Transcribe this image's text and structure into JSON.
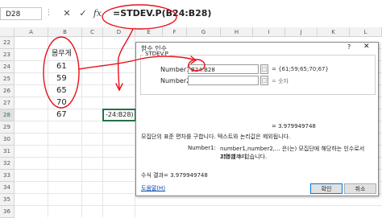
{
  "formula_bar": {
    "name_box": "D28",
    "cancel_icon": "✕",
    "enter_icon": "✓",
    "fx_label": "fx",
    "formula": "=STDEV.P(B24:B28)"
  },
  "grid": {
    "columns": [
      "A",
      "B",
      "C",
      "D",
      "E",
      "F",
      "G",
      "H",
      "I",
      "J",
      "K",
      "L"
    ],
    "rows": [
      "22",
      "23",
      "24",
      "25",
      "26",
      "27",
      "28",
      "29",
      "30",
      "31",
      "32",
      "33",
      "34",
      "35",
      "36"
    ],
    "header_cell": "몸무게",
    "values": [
      "61",
      "59",
      "65",
      "70",
      "67"
    ],
    "active_cell_text": "-24:B28)"
  },
  "dialog": {
    "title": "함수 인수",
    "function_name": "STDEV.P",
    "args": [
      {
        "label": "Number1",
        "value": "B24:B28",
        "result": "= {61;59;65;70;67}"
      },
      {
        "label": "Number2",
        "value": "",
        "result": "= 숫자"
      }
    ],
    "overall_result": "= 3.979949748",
    "description": "모집단의 표준 편차를 구합니다. 텍스트와 논리값은 제외됩니다.",
    "param_name": "Number1:",
    "param_desc_line1": "number1,number2,... 은(는) 모집단에 해당하는 인수로서 255개까지",
    "param_desc_line2": "지정할 수 있습니다.",
    "formula_result": "수식 결과= 3.979949748",
    "help_link": "도움말(H)",
    "ok_label": "확인",
    "cancel_label": "취소"
  },
  "colors": {
    "annotation": "#e8101a",
    "excel_green": "#217346"
  }
}
